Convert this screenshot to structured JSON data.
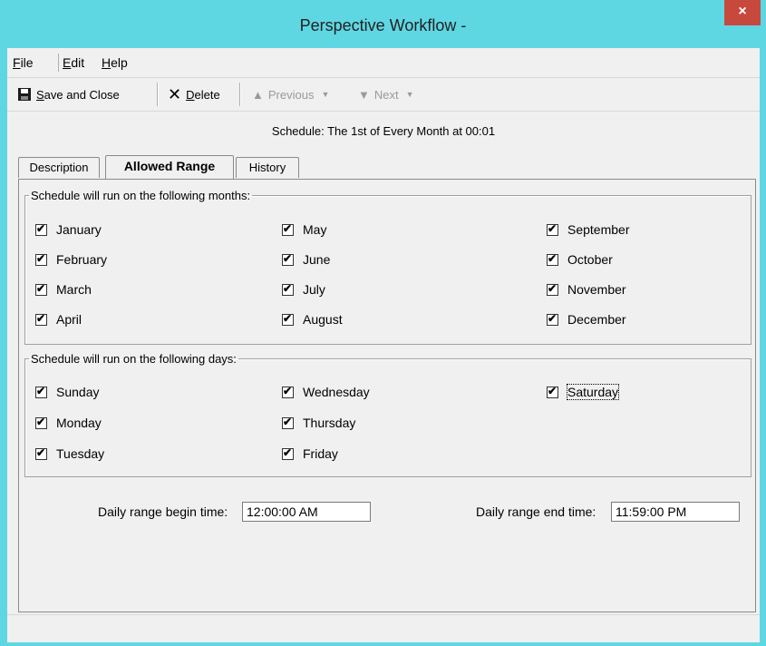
{
  "window": {
    "title": "Perspective Workflow -",
    "close_label": "×"
  },
  "menu": [
    {
      "label": "File",
      "mnemonic": "F",
      "rest": "ile"
    },
    {
      "label": "Edit",
      "mnemonic": "E",
      "rest": "dit"
    },
    {
      "label": "Help",
      "mnemonic": "H",
      "rest": "elp"
    }
  ],
  "toolbar": {
    "save_close_mn": "S",
    "save_close_rest": "ave and Close",
    "delete_mn": "D",
    "delete_rest": "elete",
    "previous_label": "Previous",
    "next_label": "Next"
  },
  "schedule_text": "Schedule:  The 1st of Every Month at 00:01",
  "tabs": [
    "Description",
    "Allowed Range",
    "History"
  ],
  "active_tab": "Allowed Range",
  "months_group": {
    "legend": "Schedule will run on the following months:",
    "items": [
      {
        "label": "January",
        "checked": true
      },
      {
        "label": "February",
        "checked": true
      },
      {
        "label": "March",
        "checked": true
      },
      {
        "label": "April",
        "checked": true
      },
      {
        "label": "May",
        "checked": true
      },
      {
        "label": "June",
        "checked": true
      },
      {
        "label": "July",
        "checked": true
      },
      {
        "label": "August",
        "checked": true
      },
      {
        "label": "September",
        "checked": true
      },
      {
        "label": "October",
        "checked": true
      },
      {
        "label": "November",
        "checked": true
      },
      {
        "label": "December",
        "checked": true
      }
    ]
  },
  "days_group": {
    "legend": "Schedule will run on the following days:",
    "items": [
      {
        "label": "Sunday",
        "checked": true
      },
      {
        "label": "Monday",
        "checked": true
      },
      {
        "label": "Tuesday",
        "checked": true
      },
      {
        "label": "Wednesday",
        "checked": true
      },
      {
        "label": "Thursday",
        "checked": true
      },
      {
        "label": "Friday",
        "checked": true
      },
      {
        "label": "Saturday",
        "checked": true
      }
    ]
  },
  "daily_range": {
    "begin_label": "Daily range begin time:",
    "begin_value": "12:00:00 AM",
    "end_label": "Daily range end time:",
    "end_value": "11:59:00 PM"
  }
}
